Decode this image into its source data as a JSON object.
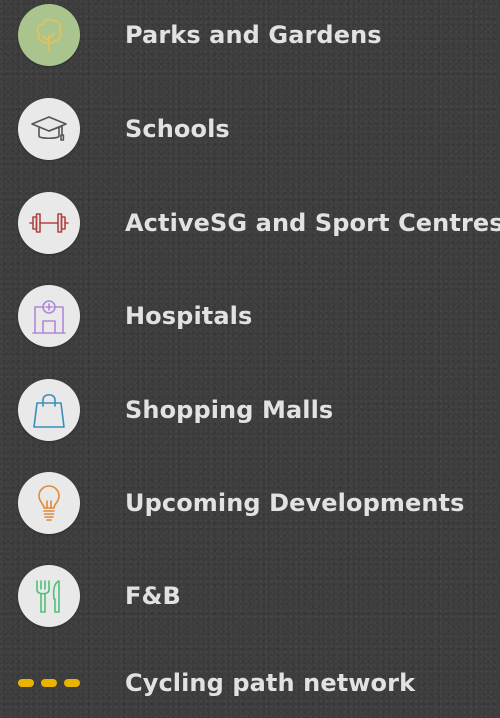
{
  "legend": {
    "items": [
      {
        "label": "Parks and Gardens",
        "icon": "tree-icon",
        "color": "#e6c25a"
      },
      {
        "label": "Schools",
        "icon": "graduation-cap-icon",
        "color": "#555555"
      },
      {
        "label": "ActiveSG and Sport Centres",
        "icon": "dumbbell-icon",
        "color": "#b04545"
      },
      {
        "label": "Hospitals",
        "icon": "hospital-icon",
        "color": "#b187d8"
      },
      {
        "label": "Shopping Malls",
        "icon": "shopping-bag-icon",
        "color": "#3a8fb8"
      },
      {
        "label": "Upcoming Developments",
        "icon": "lightbulb-icon",
        "color": "#e08a3a"
      },
      {
        "label": "F&B",
        "icon": "fork-knife-icon",
        "color": "#4fc07a"
      },
      {
        "label": "Cycling path network",
        "icon": "dashed-line-icon",
        "color": "#e8b400"
      }
    ]
  }
}
